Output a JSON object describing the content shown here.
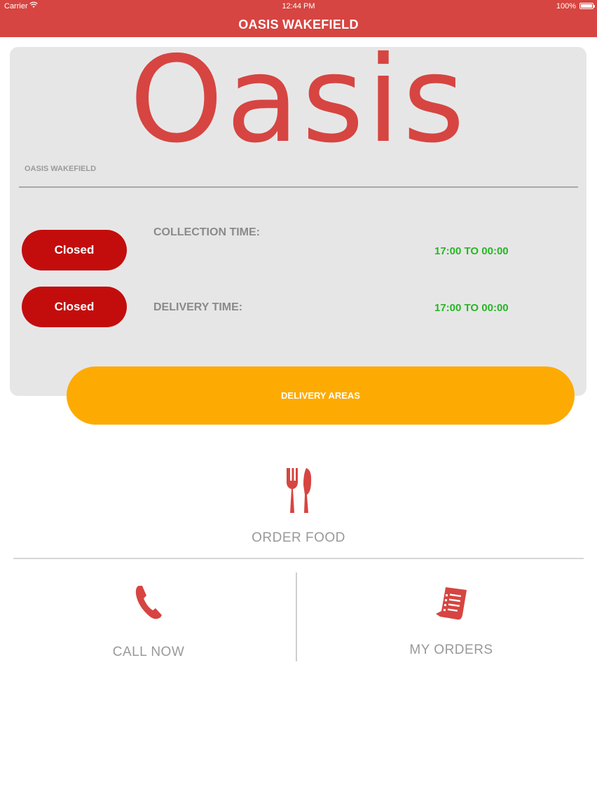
{
  "status_bar": {
    "carrier": "Carrier",
    "time": "12:44 PM",
    "battery": "100%"
  },
  "header": {
    "title": "OASIS WAKEFIELD"
  },
  "info_card": {
    "logo_text": "Oasis",
    "branch_name": "OASIS WAKEFIELD",
    "collection": {
      "status": "Closed",
      "label": "COLLECTION TIME:",
      "hours": "17:00 TO 00:00"
    },
    "delivery": {
      "status": "Closed",
      "label": "DELIVERY TIME:",
      "hours": "17:00 TO 00:00"
    },
    "delivery_areas_button": "DELIVERY AREAS"
  },
  "menu": {
    "order_food": {
      "label": "ORDER FOOD",
      "icon": "fork-knife-icon"
    },
    "call_now": {
      "label": "CALL NOW",
      "icon": "phone-icon"
    },
    "my_orders": {
      "label": "MY ORDERS",
      "icon": "receipt-icon"
    }
  },
  "colors": {
    "brand_red": "#d64541",
    "closed_red": "#c30d0d",
    "hours_green": "#26b626",
    "areas_amber": "#fdab03",
    "card_gray": "#e7e6e7"
  }
}
